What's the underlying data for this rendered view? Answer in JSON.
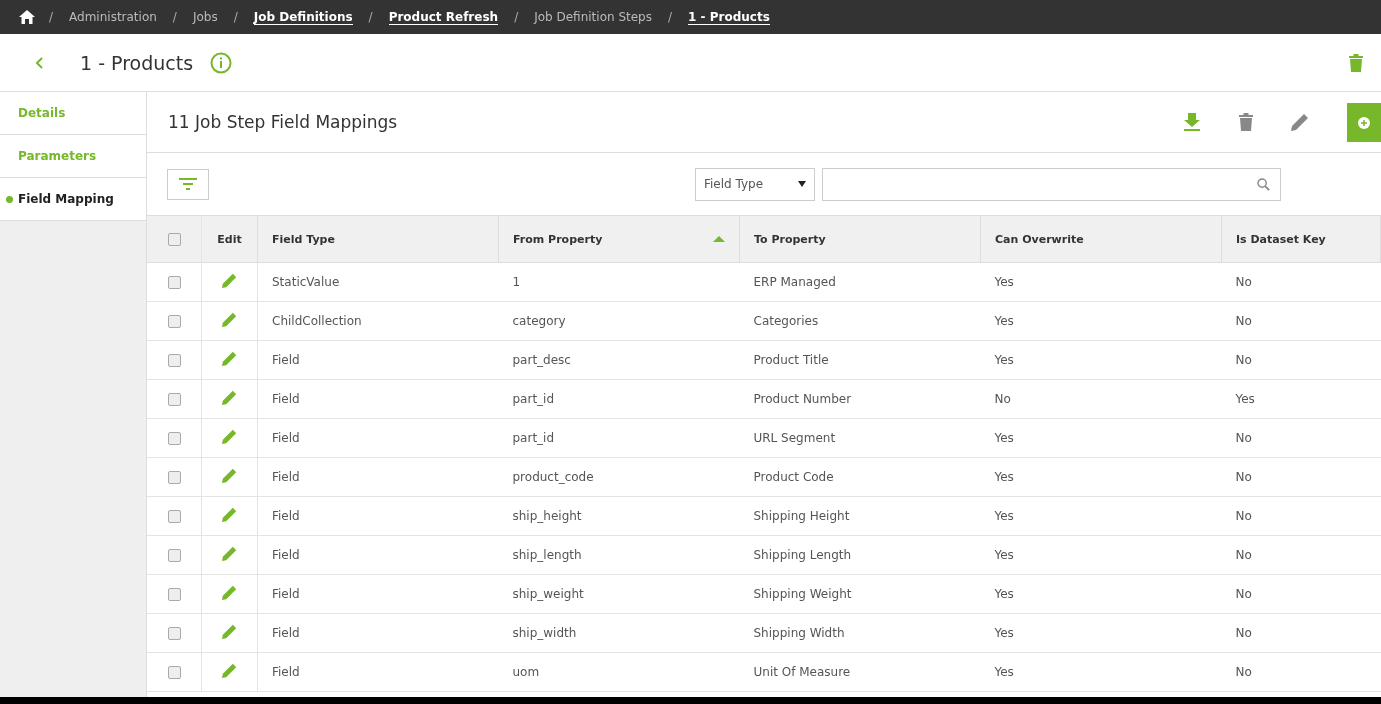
{
  "breadcrumb": [
    {
      "separator": "/",
      "label": "Administration",
      "link": false
    },
    {
      "separator": "/",
      "label": "Jobs",
      "link": false
    },
    {
      "separator": "/",
      "label": "Job Definitions",
      "link": true
    },
    {
      "separator": "/",
      "label": "Product Refresh",
      "link": true
    },
    {
      "separator": "/",
      "label": "Job Definition Steps",
      "link": false
    },
    {
      "separator": "/",
      "label": "1 - Products",
      "link": true
    }
  ],
  "header": {
    "title": "1 - Products"
  },
  "sidebar": {
    "items": [
      {
        "label": "Details",
        "selected": false
      },
      {
        "label": "Parameters",
        "selected": false
      },
      {
        "label": "Field Mapping",
        "selected": true
      }
    ]
  },
  "panel": {
    "title": "11 Job Step Field Mappings"
  },
  "filter": {
    "select_value": "Field Type"
  },
  "table": {
    "select_all_checked": false,
    "edit_header": "Edit",
    "columns": [
      {
        "label": "Field Type",
        "sort_ascending": false
      },
      {
        "label": "From Property",
        "sort_ascending": true
      },
      {
        "label": "To Property",
        "sort_ascending": false
      },
      {
        "label": "Can Overwrite",
        "sort_ascending": false
      },
      {
        "label": "Is Dataset Key",
        "sort_ascending": false
      }
    ],
    "rows": [
      {
        "checked": false,
        "cells": [
          "StaticValue",
          "1",
          "ERP Managed",
          "Yes",
          "No"
        ]
      },
      {
        "checked": false,
        "cells": [
          "ChildCollection",
          "category",
          "Categories",
          "Yes",
          "No"
        ]
      },
      {
        "checked": false,
        "cells": [
          "Field",
          "part_desc",
          "Product Title",
          "Yes",
          "No"
        ]
      },
      {
        "checked": false,
        "cells": [
          "Field",
          "part_id",
          "Product Number",
          "No",
          "Yes"
        ]
      },
      {
        "checked": false,
        "cells": [
          "Field",
          "part_id",
          "URL Segment",
          "Yes",
          "No"
        ]
      },
      {
        "checked": false,
        "cells": [
          "Field",
          "product_code",
          "Product Code",
          "Yes",
          "No"
        ]
      },
      {
        "checked": false,
        "cells": [
          "Field",
          "ship_height",
          "Shipping Height",
          "Yes",
          "No"
        ]
      },
      {
        "checked": false,
        "cells": [
          "Field",
          "ship_length",
          "Shipping Length",
          "Yes",
          "No"
        ]
      },
      {
        "checked": false,
        "cells": [
          "Field",
          "ship_weight",
          "Shipping Weight",
          "Yes",
          "No"
        ]
      },
      {
        "checked": false,
        "cells": [
          "Field",
          "ship_width",
          "Shipping Width",
          "Yes",
          "No"
        ]
      },
      {
        "checked": false,
        "cells": [
          "Field",
          "uom",
          "Unit Of Measure",
          "Yes",
          "No"
        ]
      }
    ]
  }
}
